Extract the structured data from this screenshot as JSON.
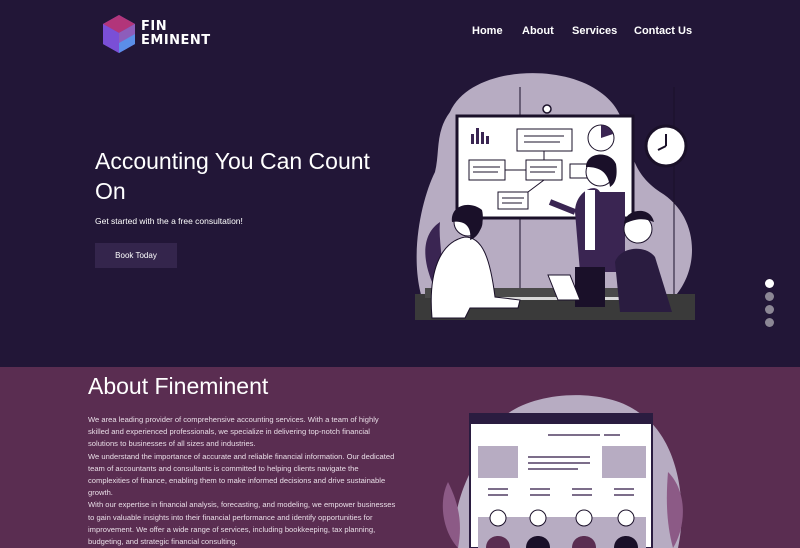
{
  "brand": {
    "line1": "FIN",
    "line2": "EMINENT"
  },
  "nav": {
    "items": [
      {
        "label": "Home"
      },
      {
        "label": "About"
      },
      {
        "label": "Services"
      },
      {
        "label": "Contact Us"
      }
    ]
  },
  "hero": {
    "title": "Accounting You Can Count On",
    "subtitle": "Get started with the a free consultation!",
    "cta_label": "Book Today",
    "slider_dots": 4,
    "active_slide": 1
  },
  "about": {
    "title": "About Fineminent",
    "paragraphs": [
      "We area leading provider of comprehensive accounting services. With a team of highly skilled and experienced professionals, we specialize in delivering top-notch financial solutions to businesses of all sizes and industries.",
      "We understand the importance of accurate and reliable financial information. Our dedicated team of accountants and consultants is committed to helping clients navigate the complexities of finance, enabling them to make informed decisions and drive sustainable growth.",
      "With our expertise in financial analysis, forecasting, and modeling, we empower businesses to gain valuable insights into their financial performance and identify opportunities for improvement. We offer a wide range of services, including bookkeeping, tax planning, budgeting, and strategic financial consulting."
    ]
  },
  "colors": {
    "hero_bg": "#221637",
    "about_bg": "#5a2d51",
    "button_bg": "#34254c",
    "accent_purple": "#3a2552",
    "lavender": "#b7acc2"
  },
  "icons": {
    "logo": "hexagon-cube-logo-icon",
    "dot": "slider-dot-icon",
    "clock": "wall-clock-icon"
  }
}
